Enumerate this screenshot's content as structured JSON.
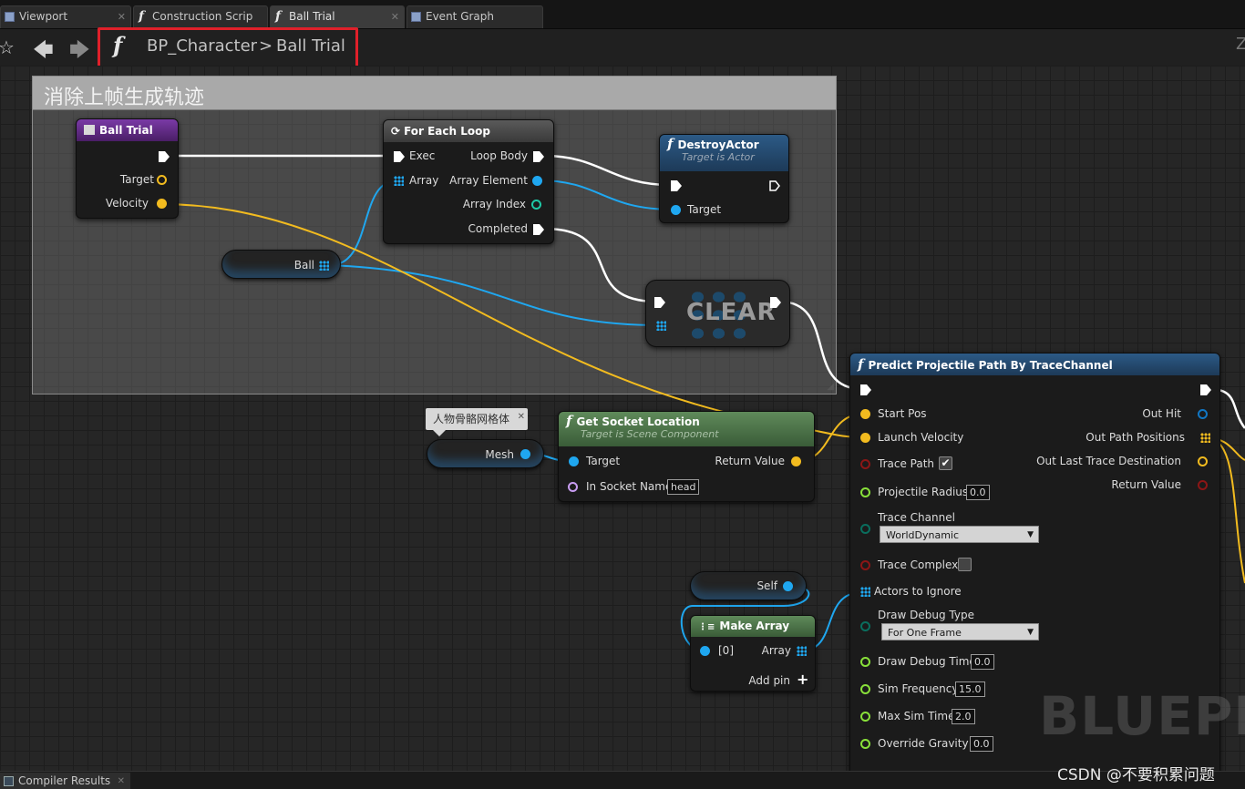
{
  "tabs": [
    {
      "label": "Viewport",
      "icon": "viewport-icon"
    },
    {
      "label": "Construction Scrip",
      "icon": "function-icon"
    },
    {
      "label": "Ball Trial",
      "icon": "function-icon",
      "active": true
    },
    {
      "label": "Event Graph",
      "icon": "event-graph-icon"
    }
  ],
  "breadcrumb": {
    "blueprint": "BP_Character",
    "separator": ">",
    "function": "Ball Trial"
  },
  "toolbar_right_text": "Z",
  "comment": {
    "title": "消除上帧生成轨迹"
  },
  "nodes": {
    "ball_trial": {
      "title": "Ball Trial",
      "target": "Target",
      "velocity": "Velocity"
    },
    "for_each": {
      "title": "For Each Loop",
      "exec": "Exec",
      "array": "Array",
      "loop_body": "Loop Body",
      "array_element": "Array Element",
      "array_index": "Array Index",
      "completed": "Completed"
    },
    "destroy": {
      "title": "DestroyActor",
      "subtitle": "Target is Actor",
      "target": "Target"
    },
    "ball_var": {
      "label": "Ball"
    },
    "clear": {
      "label": "CLEAR"
    },
    "mesh_var": {
      "label": "Mesh",
      "tooltip": "人物骨骼网格体"
    },
    "get_socket": {
      "title": "Get Socket Location",
      "subtitle": "Target is Scene Component",
      "target": "Target",
      "in_socket_name": "In Socket Name",
      "socket_value": "head",
      "return_value": "Return Value"
    },
    "self_var": {
      "label": "Self"
    },
    "make_array": {
      "title": "Make Array",
      "item0": "[0]",
      "array": "Array",
      "add_pin": "Add pin"
    },
    "predict": {
      "title": "Predict Projectile Path By TraceChannel",
      "inputs": {
        "start_pos": "Start Pos",
        "launch_velocity": "Launch Velocity",
        "trace_path": "Trace Path",
        "projectile_radius": "Projectile Radius",
        "projectile_radius_value": "0.0",
        "trace_channel": "Trace Channel",
        "trace_channel_value": "WorldDynamic",
        "trace_complex": "Trace Complex",
        "actors_to_ignore": "Actors to Ignore",
        "draw_debug_type": "Draw Debug Type",
        "draw_debug_type_value": "For One Frame",
        "draw_debug_time": "Draw Debug Time",
        "draw_debug_time_value": "0.0",
        "sim_frequency": "Sim Frequency",
        "sim_frequency_value": "15.0",
        "max_sim_time": "Max Sim Time",
        "max_sim_time_value": "2.0",
        "override_gravity_z": "Override Gravity Z",
        "override_gravity_z_value": "0.0"
      },
      "outputs": {
        "out_hit": "Out Hit",
        "out_path_positions": "Out Path Positions",
        "out_last_trace_destination": "Out Last Trace Destination",
        "return_value": "Return Value"
      },
      "trace_path_checked": true,
      "trace_complex_checked": false
    }
  },
  "watermark": "BLUEPRI",
  "status_tab": "Compiler Results",
  "credit": "CSDN @不要积累问题",
  "colors": {
    "exec": "#ffffff",
    "object": "#1fa7f0",
    "vector": "#f2bb1f",
    "bool": "#8c1616",
    "int": "#1ec9a6",
    "float": "#89e13a",
    "name": "#c79cf0",
    "byte": "#0a6e5e",
    "struct": "#1177c4"
  }
}
